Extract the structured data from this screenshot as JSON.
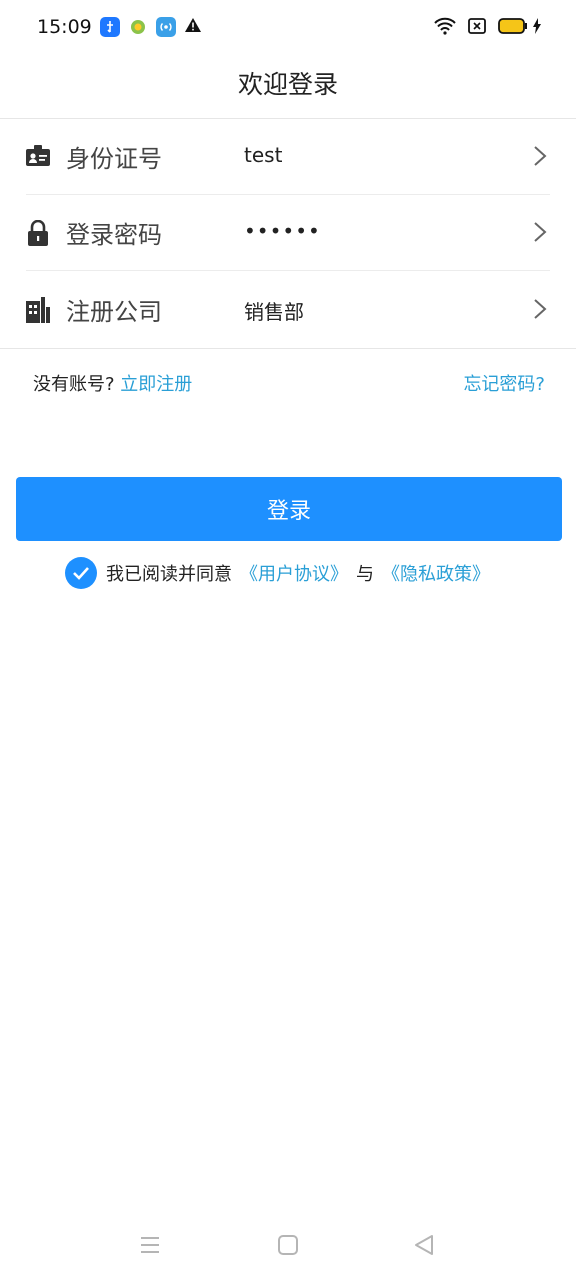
{
  "status_bar": {
    "time": "15:09",
    "left_icons": [
      "usb-icon",
      "app-badge-icon",
      "hotspot-icon",
      "warning-icon"
    ],
    "right_icons": [
      "wifi-icon",
      "no-sim-icon",
      "battery-icon",
      "charging-icon"
    ]
  },
  "header": {
    "title": "欢迎登录"
  },
  "form": {
    "rows": [
      {
        "label": "身份证号",
        "value": "test",
        "icon": "id-card-icon"
      },
      {
        "label": "登录密码",
        "value": "••••••",
        "icon": "lock-icon"
      },
      {
        "label": "注册公司",
        "value": "销售部",
        "icon": "building-icon"
      }
    ]
  },
  "links": {
    "no_account": "没有账号?",
    "register": "立即注册",
    "forgot": "忘记密码?"
  },
  "login_button": "登录",
  "agreement": {
    "prefix": "我已阅读并同意",
    "user_agreement": "《用户协议》",
    "connector": "与",
    "privacy_policy": "《隐私政策》",
    "checked": true
  },
  "colors": {
    "accent": "#1e90ff",
    "link": "#2a9fd6"
  },
  "nav": [
    "menu-icon",
    "home-icon",
    "back-icon"
  ]
}
